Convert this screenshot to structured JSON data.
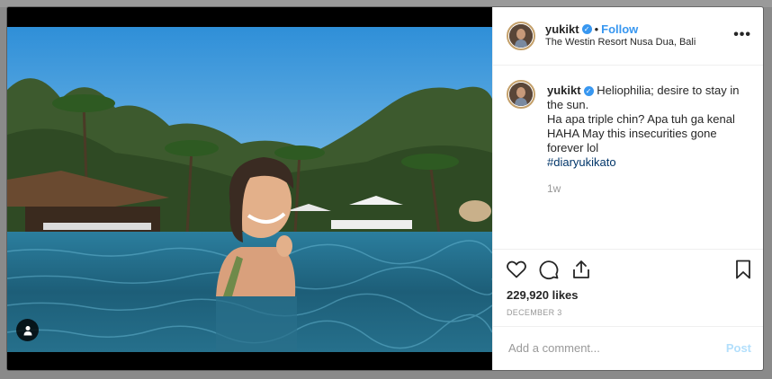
{
  "post": {
    "username": "yukikt",
    "follow_label": "Follow",
    "dot": "•",
    "location": "The Westin Resort Nusa Dua, Bali",
    "caption_username": "yukikt",
    "caption_line1": "Heliophilia; desire to stay in the sun.",
    "caption_line2": "Ha apa triple chin? Apa tuh ga kenal HAHA May this insecurities gone forever lol",
    "hashtag": "#diaryukikato",
    "age": "1w",
    "likes": "229,920 likes",
    "date": "DECEMBER 3",
    "comment_placeholder": "Add a comment...",
    "post_label": "Post",
    "more_label": "•••",
    "verified_mark": "✓"
  },
  "icons": {
    "like": "heart-icon",
    "comment": "comment-icon",
    "share": "share-icon",
    "save": "bookmark-icon",
    "tag": "person-tag-icon"
  },
  "colors": {
    "accent": "#3897f0",
    "post_disabled": "#b2dffc",
    "hashtag": "#003569"
  }
}
